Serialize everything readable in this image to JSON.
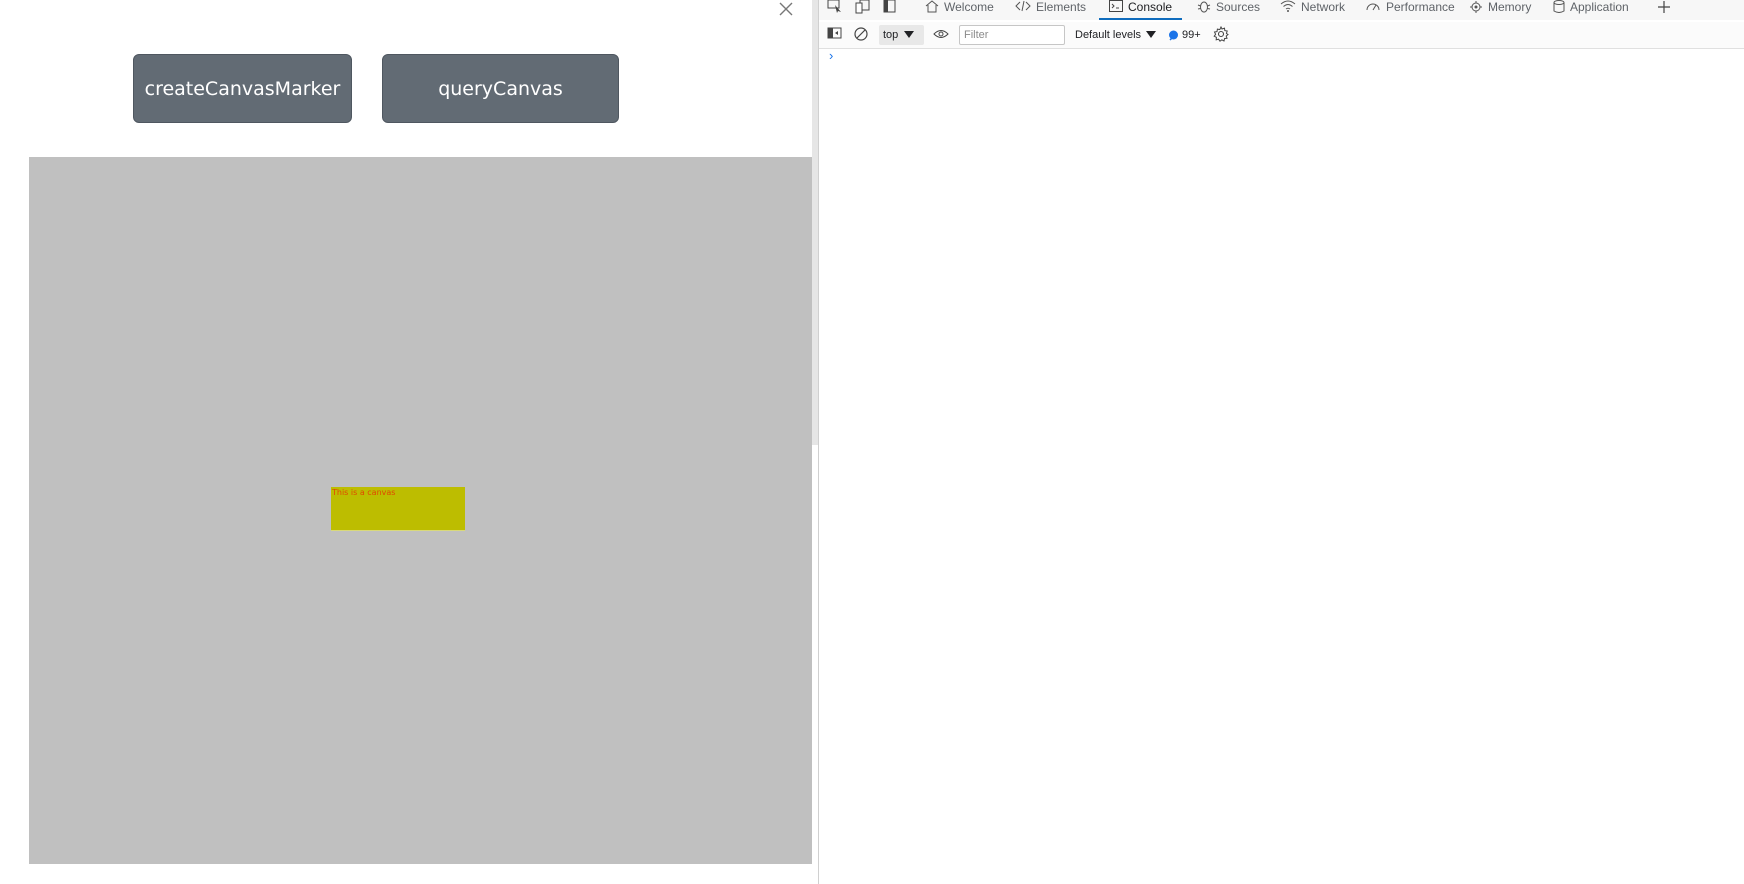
{
  "page": {
    "buttons": {
      "create_marker": "createCanvasMarker",
      "query_canvas": "queryCanvas"
    },
    "canvas": {
      "marker_text": "This is a canvas",
      "background_color": "#c0c0c0",
      "marker_color": "#bdbd00"
    },
    "close_icon": "close-icon"
  },
  "devtools": {
    "tabs": [
      {
        "label": "Welcome",
        "icon": "home-icon"
      },
      {
        "label": "Elements",
        "icon": "code-icon"
      },
      {
        "label": "Console",
        "icon": "console-icon",
        "active": true
      },
      {
        "label": "Sources",
        "icon": "bug-icon"
      },
      {
        "label": "Network",
        "icon": "wifi-icon"
      },
      {
        "label": "Performance",
        "icon": "gauge-icon"
      },
      {
        "label": "Memory",
        "icon": "memory-icon"
      },
      {
        "label": "Application",
        "icon": "database-icon"
      }
    ],
    "toolbar": {
      "context": "top",
      "filter_placeholder": "Filter",
      "levels": "Default levels",
      "issues_count": "99+"
    },
    "prompt_symbol": "›",
    "accent_color": "#0f6cbd"
  }
}
